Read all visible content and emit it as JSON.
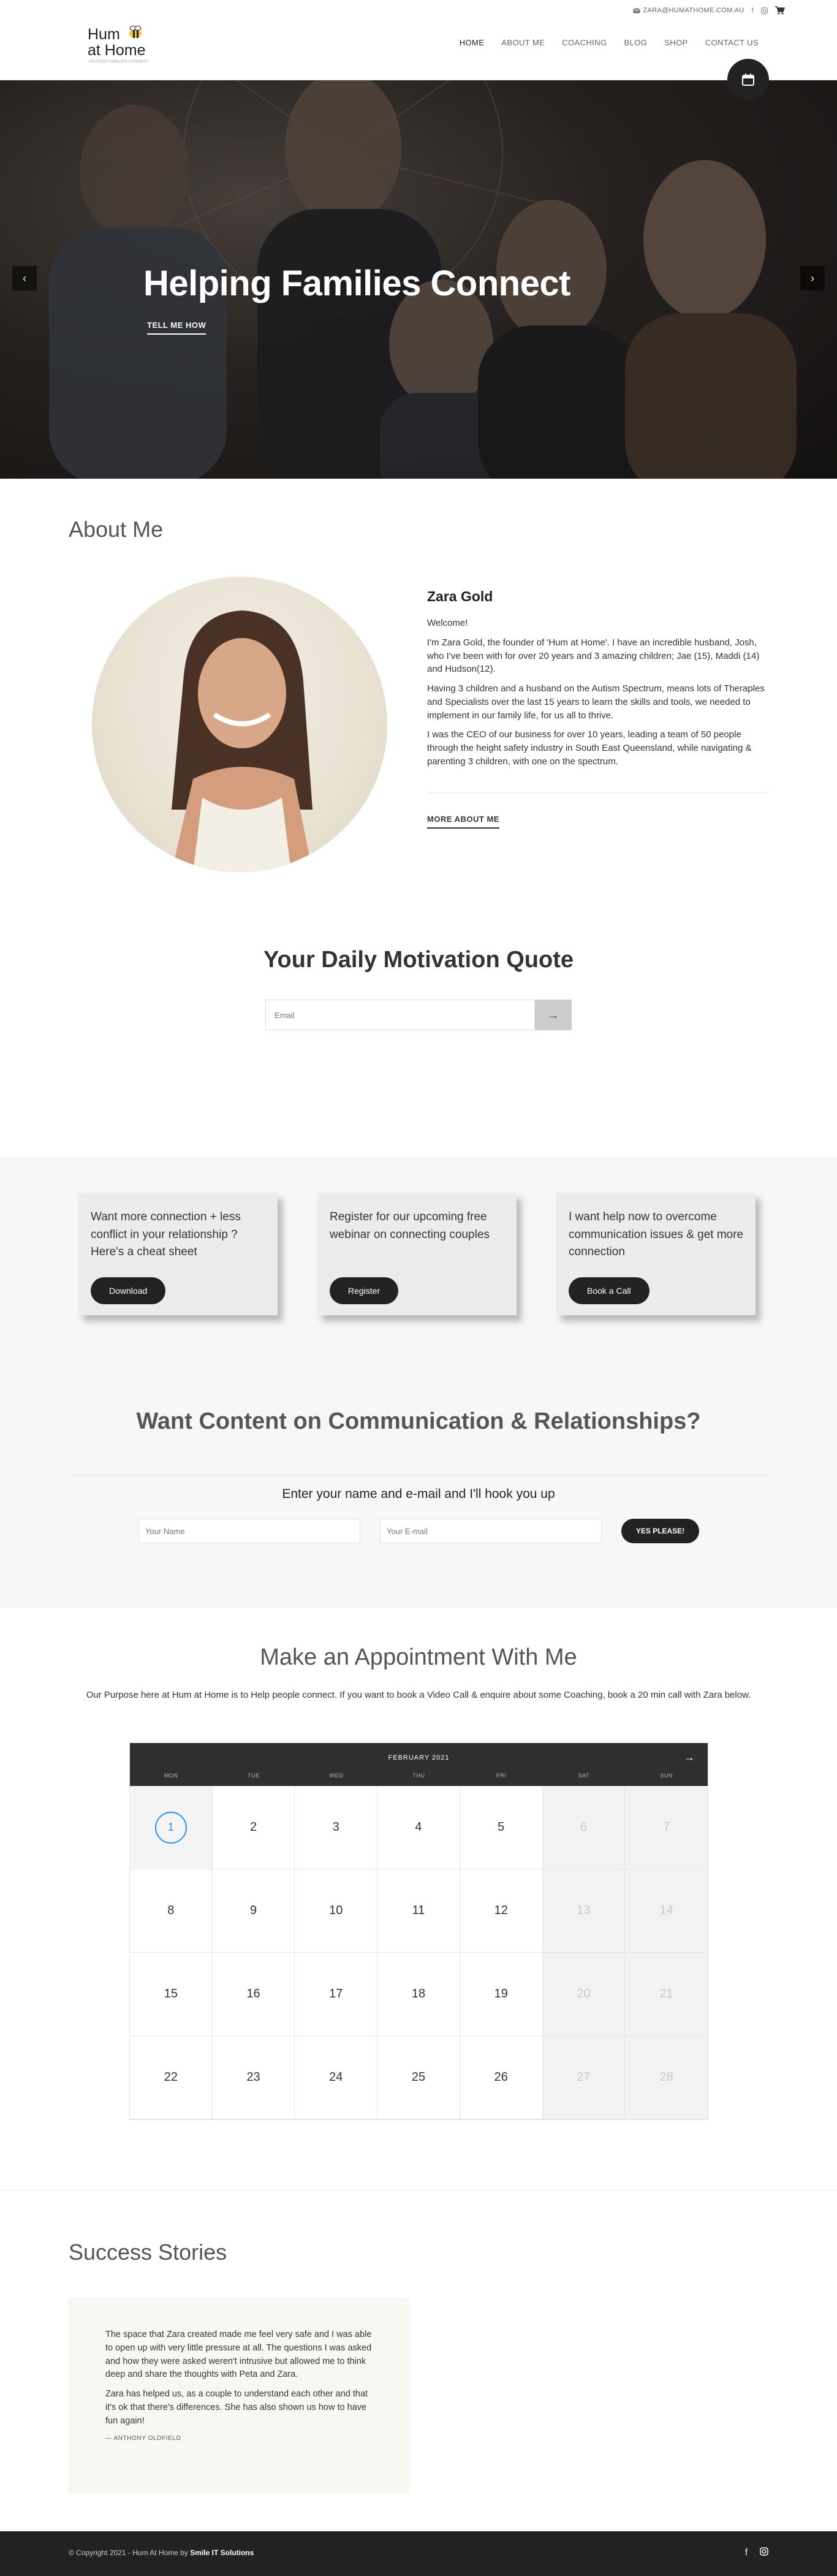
{
  "topbar": {
    "email": "ZARA@HUMATHOME.COM.AU"
  },
  "logo": {
    "line1": "Hum",
    "line2": "at Home",
    "tagline": "HELPING FAMILIES CONNECT"
  },
  "nav": {
    "items": [
      "HOME",
      "ABOUT ME",
      "COACHING",
      "BLOG",
      "SHOP",
      "CONTACT US"
    ]
  },
  "hero": {
    "title": "Helping Families Connect",
    "cta": "TELL ME HOW"
  },
  "about": {
    "heading": "About Me",
    "name": "Zara Gold",
    "greeting": "Welcome!",
    "p1": "I'm Zara Gold, the founder of 'Hum at Home'. I have an incredible husband, Josh, who I've been with for over 20 years and 3 amazing children; Jae (15), Maddi (14) and Hudson(12).",
    "p2": "Having 3 children and a husband on the Autism Spectrum, means lots of Theraples and Specialists over the last 15 years to learn the skills and tools, we needed to implement in our family life, for us all to thrive.",
    "p3": "I was the CEO of our business for over 10 years, leading a team of 50 people through the height safety industry in South East Queensland, while navigating & parenting 3 children, with one on the spectrum.",
    "more": "MORE ABOUT ME"
  },
  "quote": {
    "heading": "Your Daily Motivation Quote",
    "email_placeholder": "Email",
    "submit": "→"
  },
  "offers": [
    {
      "text": "Want more connection + less conflict in your relationship ? Here's a cheat sheet",
      "button": "Download"
    },
    {
      "text": "Register for our upcoming free webinar on connecting couples",
      "button": "Register"
    },
    {
      "text": "I want help now to overcome communication issues & get more connection",
      "button": "Book a Call"
    }
  ],
  "subscribe": {
    "heading": "Want Content on Communication & Relationships?",
    "lead": "Enter your name and e-mail and I'll hook you up",
    "name_placeholder": "Your Name",
    "email_placeholder": "Your E-mail",
    "button": "YES PLEASE!"
  },
  "appointment": {
    "heading": "Make an Appointment With Me",
    "lead": "Our Purpose here at Hum at Home is to Help people connect. If you want to book a Video Call & enquire about some Coaching, book a 20 min call with Zara below.",
    "month": "FEBRUARY 2021",
    "next": "→",
    "weekdays": [
      "MON",
      "TUE",
      "WED",
      "THU",
      "FRI",
      "SAT",
      "SUN"
    ],
    "today": "1",
    "weeks": [
      [
        "1",
        "2",
        "3",
        "4",
        "5",
        "6",
        "7"
      ],
      [
        "8",
        "9",
        "10",
        "11",
        "12",
        "13",
        "14"
      ],
      [
        "15",
        "16",
        "17",
        "18",
        "19",
        "20",
        "21"
      ],
      [
        "22",
        "23",
        "24",
        "25",
        "26",
        "27",
        "28"
      ]
    ]
  },
  "success": {
    "heading": "Success Stories",
    "p1": "The space that Zara created made me feel very safe and I was able to open up with very little pressure at all. The questions I was asked and how they were asked weren't intrusive but allowed me to think deep and share the thoughts with Peta and Zara.",
    "p2": "Zara has helped us, as a couple to understand each other and that it's ok that there's differences. She has also shown us how to have fun again!",
    "author": "— ANTHONY OLDFIELD"
  },
  "footer": {
    "copy": "© Copyright 2021 - Hum At Home by ",
    "company": "Smile IT Solutions"
  }
}
